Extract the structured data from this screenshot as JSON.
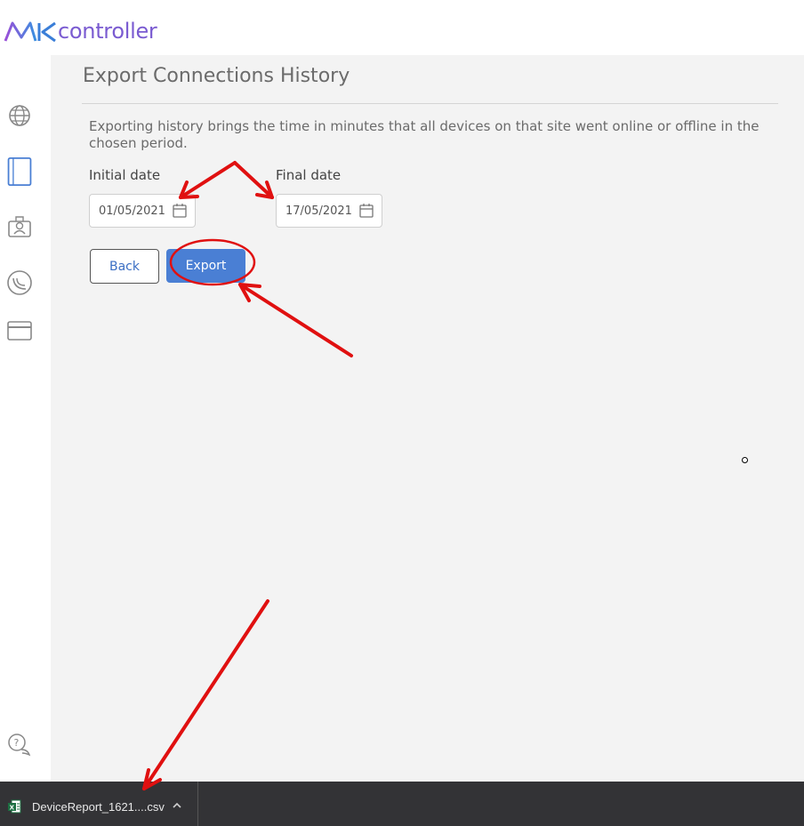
{
  "brand": {
    "logo_text": "controller"
  },
  "page": {
    "title": "Export Connections History",
    "description": "Exporting history brings the time in minutes that all devices on that site went online or offline in the chosen period."
  },
  "form": {
    "initial_label": "Initial date",
    "initial_value": "01/05/2021",
    "final_label": "Final date",
    "final_value": "17/05/2021",
    "back_label": "Back",
    "export_label": "Export"
  },
  "sidebar": {
    "items": [
      {
        "icon": "globe-icon"
      },
      {
        "icon": "book-icon"
      },
      {
        "icon": "user-badge-icon"
      },
      {
        "icon": "wireless-icon"
      },
      {
        "icon": "card-icon"
      },
      {
        "icon": "help-chat-icon"
      }
    ]
  },
  "download": {
    "file_name": "DeviceReport_1621....csv",
    "icon": "excel-file-icon"
  },
  "colors": {
    "accent": "#4a7fd4",
    "annotation": "#e01010",
    "brand": "#7a5bd1"
  }
}
